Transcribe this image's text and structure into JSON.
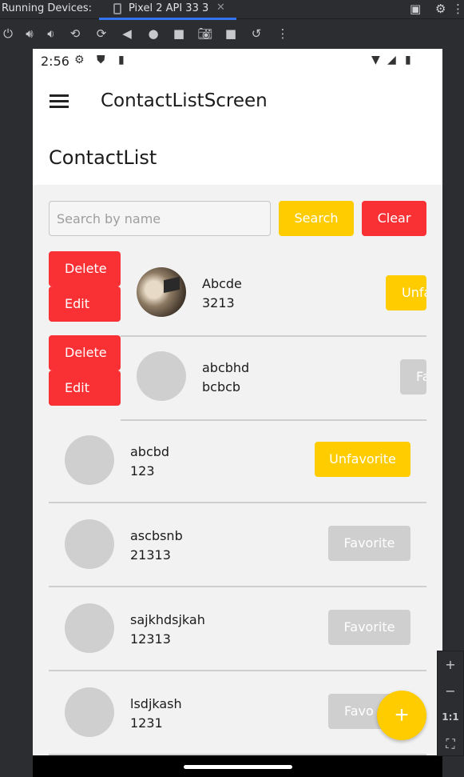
{
  "ide": {
    "running_devices_label": "Running Devices:",
    "device_tab": "Pixel 2 API 33 3",
    "close_glyph": "✕",
    "toolbar_icons": [
      "power-icon",
      "volume-up-icon",
      "volume-down-icon",
      "rotate-left-icon",
      "rotate-right-icon",
      "back-icon",
      "home-icon",
      "overview-icon",
      "camera-icon",
      "video-icon",
      "restore-icon",
      "more-icon"
    ],
    "zoom": {
      "plus": "+",
      "minus": "−",
      "one_to_one": "1:1"
    }
  },
  "status_bar": {
    "time": "2:56"
  },
  "app_bar": {
    "title": "ContactListScreen"
  },
  "page": {
    "title": "ContactList"
  },
  "search": {
    "placeholder": "Search by name",
    "value": "",
    "search_label": "Search",
    "clear_label": "Clear"
  },
  "swipe_actions": {
    "delete_label": "Delete",
    "edit_label": "Edit"
  },
  "contacts": [
    {
      "name": "Abcde",
      "phone": "3213",
      "fav_label": "Unfa",
      "favorite": true,
      "has_photo": true,
      "swiped": true
    },
    {
      "name": "abcbhd",
      "phone": "bcbcb",
      "fav_label": "Fa",
      "favorite": false,
      "has_photo": false,
      "swiped": true
    },
    {
      "name": "abcbd",
      "phone": "123",
      "fav_label": "Unfavorite",
      "favorite": true,
      "has_photo": false,
      "swiped": false
    },
    {
      "name": "ascbsnb",
      "phone": "21313",
      "fav_label": "Favorite",
      "favorite": false,
      "has_photo": false,
      "swiped": false
    },
    {
      "name": "sajkhdsjkah",
      "phone": "12313",
      "fav_label": "Favorite",
      "favorite": false,
      "has_photo": false,
      "swiped": false
    },
    {
      "name": "lsdjkash",
      "phone": "1231",
      "fav_label": "Favo",
      "favorite": false,
      "has_photo": false,
      "swiped": false
    }
  ],
  "fab": {
    "label": "+"
  },
  "colors": {
    "accent": "#ffcc00",
    "danger": "#f93135",
    "neutral": "#cfcfcf"
  }
}
